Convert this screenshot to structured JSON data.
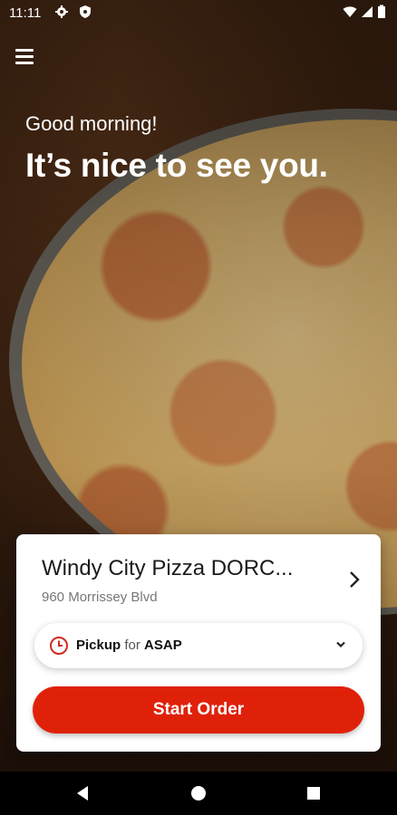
{
  "status_bar": {
    "time": "11:11",
    "icons": [
      "settings-gear-icon",
      "shield-icon",
      "wifi-icon",
      "cellular-signal-icon",
      "battery-icon"
    ]
  },
  "header": {
    "menu_icon": "hamburger-menu-icon"
  },
  "hero": {
    "greeting": "Good morning!",
    "headline": "It’s nice to see you."
  },
  "order_card": {
    "store_name": "Windy City Pizza DORC...",
    "store_address": "960 Morrissey Blvd",
    "pickup": {
      "mode": "Pickup",
      "connector": "for",
      "time": "ASAP"
    },
    "start_order_label": "Start Order"
  },
  "colors": {
    "accent": "#E0210A",
    "card_bg": "#FFFFFF",
    "clock_icon": "#D42A1E"
  },
  "navbar": {
    "icons": [
      "back-triangle-icon",
      "home-circle-icon",
      "recents-square-icon"
    ]
  }
}
